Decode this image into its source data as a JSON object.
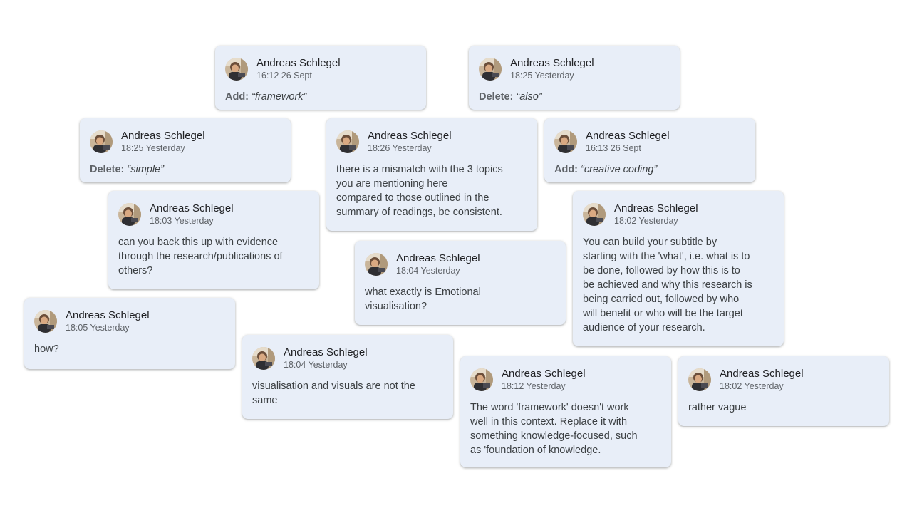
{
  "comments": [
    {
      "id": "c1",
      "author": "Andreas Schlegel",
      "time": "16:12 26 Sept",
      "kind": "suggestion",
      "label": "Add:",
      "text": "“framework”"
    },
    {
      "id": "c2",
      "author": "Andreas Schlegel",
      "time": "18:25 Yesterday",
      "kind": "suggestion",
      "label": "Delete:",
      "text": "“also”"
    },
    {
      "id": "c3",
      "author": "Andreas Schlegel",
      "time": "18:25 Yesterday",
      "kind": "suggestion",
      "label": "Delete:",
      "text": "“simple”"
    },
    {
      "id": "c4",
      "author": "Andreas Schlegel",
      "time": "18:26 Yesterday",
      "kind": "comment",
      "lines": [
        "there is a mismatch with the 3 topics",
        "you are mentioning here",
        "compared to those outlined in the",
        "summary of readings, be consistent."
      ]
    },
    {
      "id": "c5",
      "author": "Andreas Schlegel",
      "time": "16:13 26 Sept",
      "kind": "suggestion",
      "label": "Add:",
      "text": "“creative coding”"
    },
    {
      "id": "c6",
      "author": "Andreas Schlegel",
      "time": "18:03 Yesterday",
      "kind": "comment",
      "lines": [
        "can you back this up with evidence",
        "through the research/publications of",
        "others?"
      ]
    },
    {
      "id": "c7",
      "author": "Andreas Schlegel",
      "time": "18:02 Yesterday",
      "kind": "comment",
      "lines": [
        "You can build your subtitle by",
        "starting with the 'what', i.e. what is to",
        "be done, followed by how this is to",
        "be achieved and why this research is",
        "being carried out, followed by who",
        "will benefit or who will be the target",
        "audience of your research."
      ]
    },
    {
      "id": "c8",
      "author": "Andreas Schlegel",
      "time": "18:04 Yesterday",
      "kind": "comment",
      "lines": [
        "what exactly is Emotional",
        "visualisation?"
      ]
    },
    {
      "id": "c9",
      "author": "Andreas Schlegel",
      "time": "18:05 Yesterday",
      "kind": "comment",
      "lines": [
        "how?"
      ]
    },
    {
      "id": "c10",
      "author": "Andreas Schlegel",
      "time": "18:04 Yesterday",
      "kind": "comment",
      "lines": [
        "visualisation and visuals are not the",
        "same"
      ]
    },
    {
      "id": "c11",
      "author": "Andreas Schlegel",
      "time": "18:12 Yesterday",
      "kind": "comment",
      "lines": [
        "The word 'framework' doesn't work",
        "well in this context. Replace it with",
        "something knowledge-focused, such",
        "as 'foundation of knowledge."
      ]
    },
    {
      "id": "c12",
      "author": "Andreas Schlegel",
      "time": "18:02 Yesterday",
      "kind": "comment",
      "lines": [
        "rather vague"
      ]
    }
  ],
  "colors": {
    "card_bg": "#e8eef8",
    "name": "#202124",
    "meta": "#5f6368",
    "body": "#3c4043"
  },
  "icons": {
    "avatar": "user-photo-avatar"
  }
}
